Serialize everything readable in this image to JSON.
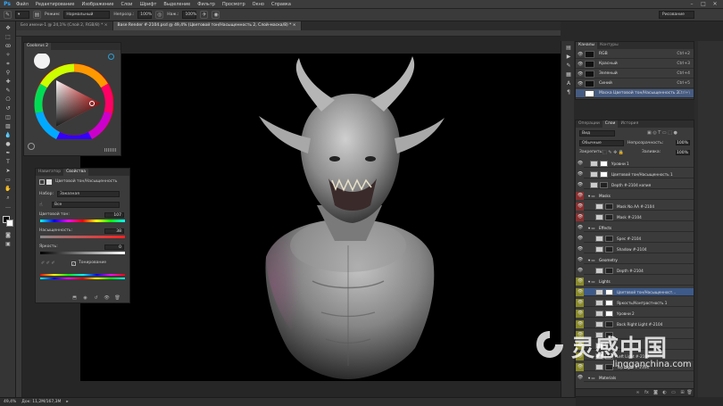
{
  "app": {
    "logo": "Ps",
    "menu": [
      "Файл",
      "Редактирование",
      "Изображение",
      "Слои",
      "Шрифт",
      "Выделение",
      "Фильтр",
      "Просмотр",
      "Окно",
      "Справка"
    ],
    "window_controls": [
      "–",
      "□",
      "✕"
    ],
    "workspace": "Рисование"
  },
  "options_bar": {
    "mode_label": "Режим:",
    "mode_value": "Нормальный",
    "opacity_label": "Непрозр.:",
    "opacity_value": "100%",
    "pressure_label": "Наж.:",
    "pressure_value": "100%"
  },
  "tabs": [
    {
      "label": "Без имени-1 @ 24,1% (Слой 2, RGB/8) *  ×",
      "active": false
    },
    {
      "label": "Base Render #-2104.psd @ 49,4% (Цветовой тон/Насыщенность 2, Слой-маска/8) *  ×",
      "active": true
    }
  ],
  "status": {
    "zoom": "49,4%",
    "doc_size": "Док: 11,2M/167,3M"
  },
  "color_panel": {
    "tabs": [
      "Coolorus 2"
    ]
  },
  "properties_panel": {
    "tabs": [
      "Навигатор",
      "Свойства"
    ],
    "title": "Цветовой тон/Насыщенность",
    "preset_label": "Набор:",
    "preset_value": "Заказная",
    "channel_value": "Все",
    "hue_label": "Цветовой тон:",
    "hue_value": "107",
    "saturation_label": "Насыщенность:",
    "saturation_value": "38",
    "lightness_label": "Яркость:",
    "lightness_value": "0",
    "colorize_label": "Тонирование"
  },
  "channels_panel": {
    "tabs": [
      "Каналы",
      "Контуры"
    ],
    "rows": [
      {
        "name": "RGB",
        "shortcut": "Ctrl+2"
      },
      {
        "name": "Красный",
        "shortcut": "Ctrl+3"
      },
      {
        "name": "Зеленый",
        "shortcut": "Ctrl+4"
      },
      {
        "name": "Синий",
        "shortcut": "Ctrl+5"
      },
      {
        "name": "Маска Цветовой тон/Насыщенность 2",
        "shortcut": "Ctrl+\\"
      }
    ]
  },
  "layers_panel": {
    "tabs": [
      "Операции",
      "Слои",
      "История"
    ],
    "filter_label": "Вид",
    "blend_mode": "Обычные",
    "opacity_label": "Непрозрачность:",
    "opacity_value": "100%",
    "lock_label": "Закрепить:",
    "fill_label": "Заливка:",
    "fill_value": "100%",
    "layers": [
      {
        "name": "Уровни 1",
        "color": "#3b3b3b",
        "indent": 0,
        "type": "adj"
      },
      {
        "name": "Цветовой тон/Насыщенность 1",
        "color": "#3b3b3b",
        "indent": 0,
        "type": "adj"
      },
      {
        "name": "Depth #-2104 копия",
        "color": "#3b3b3b",
        "indent": 0,
        "type": "img"
      },
      {
        "name": "Masks",
        "color": "#8a2f2f",
        "indent": 0,
        "type": "group"
      },
      {
        "name": "Mask No AA #-2104",
        "color": "#8a2f2f",
        "indent": 1,
        "type": "img"
      },
      {
        "name": "Mask #-2104",
        "color": "#8a2f2f",
        "indent": 1,
        "type": "img"
      },
      {
        "name": "Effects",
        "color": "#3b3b3b",
        "indent": 0,
        "type": "group"
      },
      {
        "name": "Spec #-2104",
        "color": "#3b3b3b",
        "indent": 1,
        "type": "img"
      },
      {
        "name": "Shadow #-2104",
        "color": "#3b3b3b",
        "indent": 1,
        "type": "img"
      },
      {
        "name": "Geometry",
        "color": "#3b3b3b",
        "indent": 0,
        "type": "group"
      },
      {
        "name": "Depth #-2104",
        "color": "#3b3b3b",
        "indent": 1,
        "type": "img"
      },
      {
        "name": "Lights",
        "color": "#8a8a2a",
        "indent": 0,
        "type": "group"
      },
      {
        "name": "Цветовой тон/Насыщенност...",
        "color": "#8a8a2a",
        "indent": 1,
        "type": "adj",
        "selected": true
      },
      {
        "name": "Яркость/Контрастность 1",
        "color": "#8a8a2a",
        "indent": 1,
        "type": "adj"
      },
      {
        "name": "Уровни 2",
        "color": "#8a8a2a",
        "indent": 1,
        "type": "adj"
      },
      {
        "name": "Back Right Light #-2104",
        "color": "#8a8a2a",
        "indent": 1,
        "type": "img"
      },
      {
        "name": "",
        "color": "#8a8a2a",
        "indent": 1,
        "type": "img"
      },
      {
        "name": "",
        "color": "#8a8a2a",
        "indent": 1,
        "type": "img"
      },
      {
        "name": "Left Light #-2104",
        "color": "#8a8a2a",
        "indent": 1,
        "type": "img"
      },
      {
        "name": "Top Light #-2104",
        "color": "#8a8a2a",
        "indent": 1,
        "type": "img"
      },
      {
        "name": "Materials",
        "color": "#3b3b3b",
        "indent": 0,
        "type": "group"
      }
    ]
  },
  "watermark": {
    "cn": "灵感中国",
    "en": "lingganchina.com"
  },
  "colors": {
    "accent": "#31a8ff",
    "selection": "#3d5a8a"
  }
}
